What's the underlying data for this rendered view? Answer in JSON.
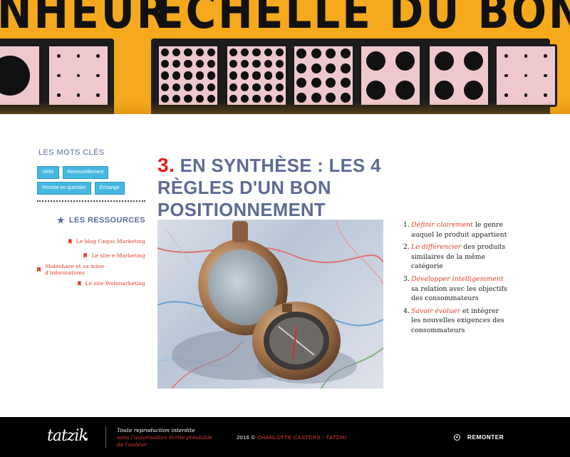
{
  "hero": {
    "title_left": "NHEUR",
    "title_right": "ÉCHELLE DU BONHEUR",
    "image_icon": "dice-tiles-image"
  },
  "sidebar": {
    "keywords_heading": "LES MOTS CLÉS",
    "tags": [
      "Veille",
      "Renouvellement",
      "Remise en question",
      "Echange"
    ],
    "resources_heading": "LES RESSOURCES",
    "resources_icon": "star-icon",
    "resources": [
      "Le blog Cegos Marketing",
      "Le site e-Marketing",
      "Slideshare et sa mine d'informations",
      "Le site Webmarketing"
    ]
  },
  "main": {
    "number": "3.",
    "title": "EN SYNTHÈSE : LES 4 RÈGLES D'UN BON POSITIONNEMENT",
    "photo_icon": "compass-on-map-image",
    "rules": [
      {
        "num": "1.",
        "highlight": "Définir clairement",
        "text": " le genre auquel le produit appartient"
      },
      {
        "num": "2.",
        "highlight": "Le différencier",
        "text": " des produits similaires de la même catégorie"
      },
      {
        "num": "3.",
        "highlight": "Développer intelligemment",
        "text": " sa relation avec les objectifs des consommateurs"
      },
      {
        "num": "4.",
        "highlight": "Savoir évoluer",
        "text": " et intégrer les nouvelles exigences des consommateurs"
      }
    ]
  },
  "footer": {
    "logo": "tatzik",
    "legal_line1": "Toute reproduction interdite",
    "legal_line2": "sans l'autorisation écrite préalable",
    "legal_line3": "de l'auteur",
    "copyright_prefix": "2016 ©",
    "copyright_author": "CHARLOTTE CASTERS - TATZIKI",
    "back_to_top": "REMONTER"
  },
  "colors": {
    "accent_red": "#e5412f",
    "title_blue": "#5c6b95",
    "tag_blue": "#45b8e1",
    "hero_yellow": "#f6a91d"
  }
}
